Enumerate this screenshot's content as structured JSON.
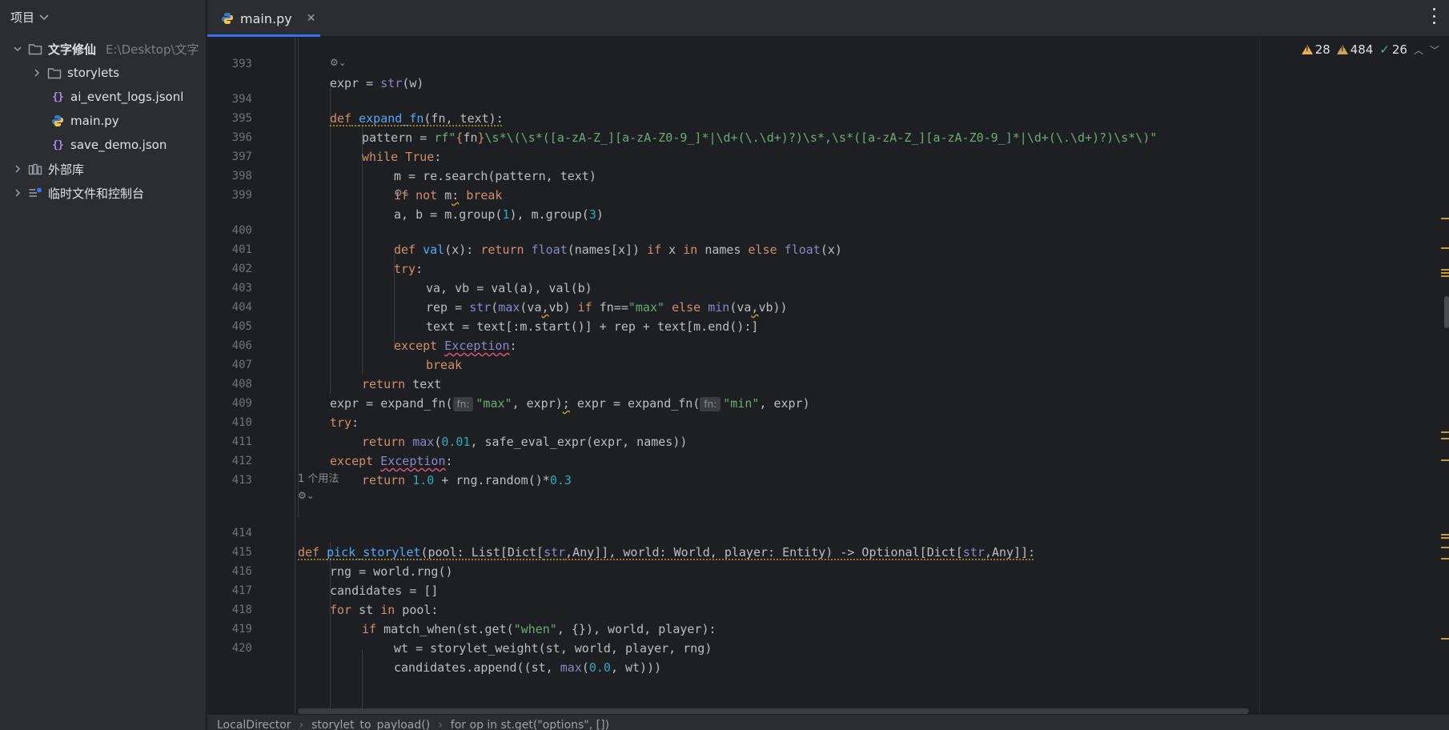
{
  "sidebar": {
    "title": "项目",
    "project": {
      "name": "文字修仙",
      "path": "E:\\Desktop\\文字"
    },
    "items": [
      {
        "label": "storylets",
        "type": "folder"
      },
      {
        "label": "ai_event_logs.jsonl",
        "type": "json"
      },
      {
        "label": "main.py",
        "type": "python"
      },
      {
        "label": "save_demo.json",
        "type": "json"
      }
    ],
    "external_libs": "外部库",
    "scratches": "临时文件和控制台"
  },
  "tab": {
    "label": "main.py"
  },
  "inspections": {
    "warnings": "28",
    "weak_warnings": "484",
    "ok": "26"
  },
  "editor": {
    "usage_hint": "1 个用法",
    "param_hint": "fn:",
    "line_numbers": [
      "393",
      "394",
      "395",
      "396",
      "397",
      "398",
      "399",
      "400",
      "401",
      "402",
      "403",
      "404",
      "405",
      "406",
      "407",
      "408",
      "409",
      "410",
      "411",
      "412",
      "413",
      "414",
      "415",
      "416",
      "417",
      "418",
      "419",
      "420"
    ]
  },
  "breadcrumbs": [
    "LocalDirector",
    "storylet_to_payload()",
    "for op in st.get(\"options\", [])"
  ]
}
